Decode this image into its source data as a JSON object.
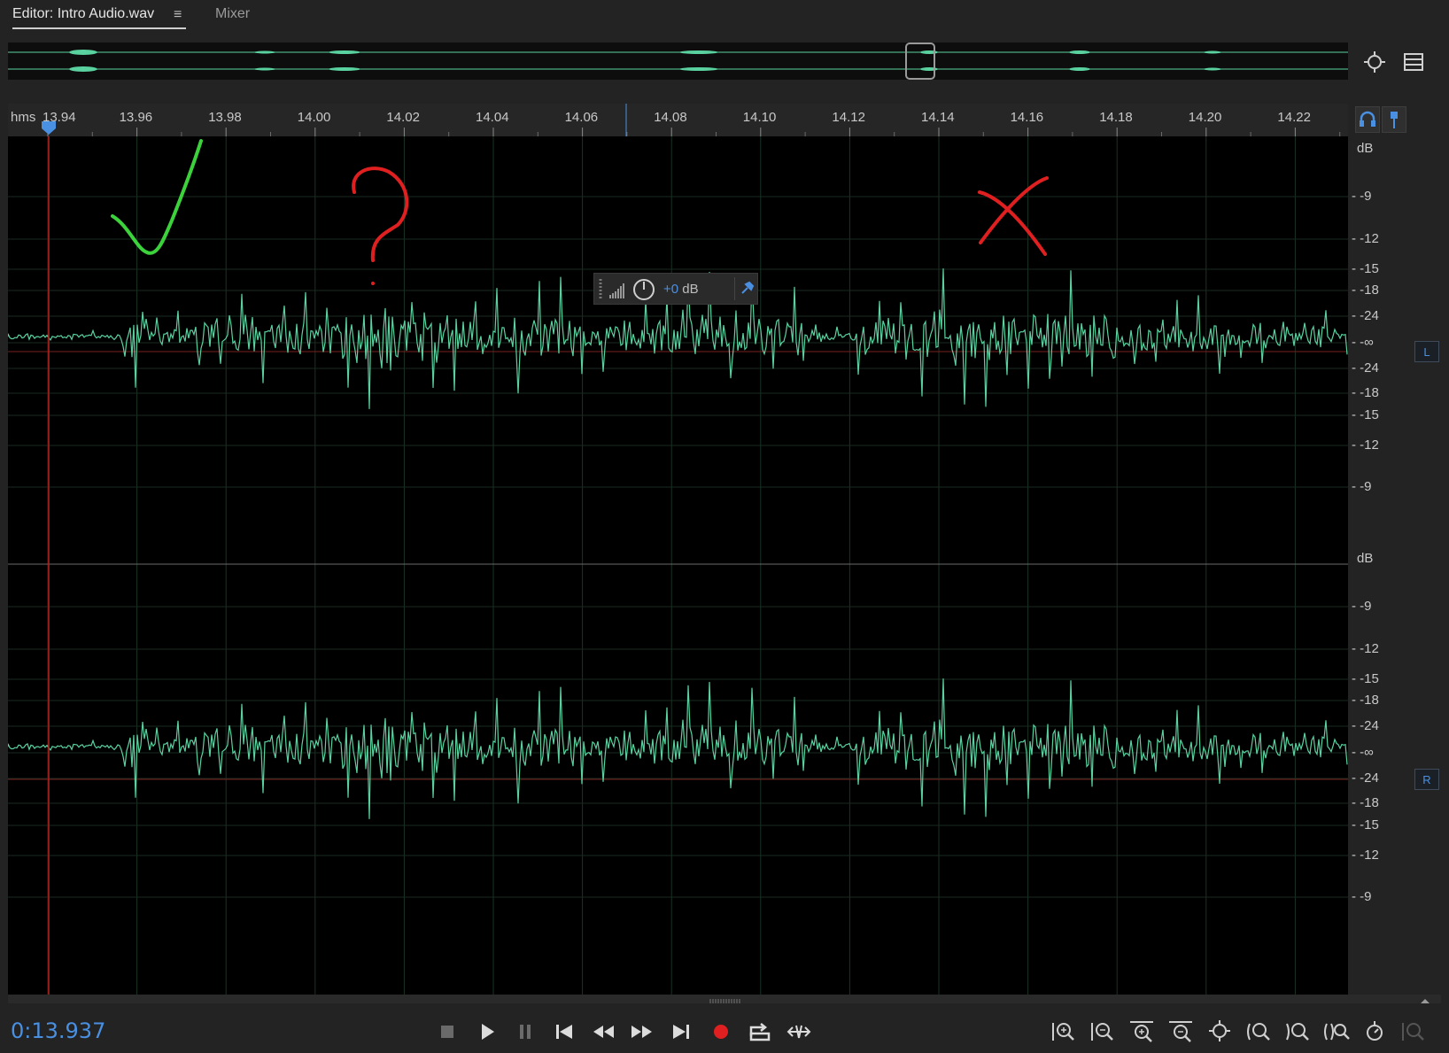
{
  "tabs": {
    "editor_label": "Editor: Intro Audio.wav",
    "menu_glyph": "≡",
    "mixer_label": "Mixer"
  },
  "ruler": {
    "unit_label": "hms",
    "ticks": [
      "13.94",
      "13.96",
      "13.98",
      "14.00",
      "14.02",
      "14.04",
      "14.06",
      "14.08",
      "14.10",
      "14.12",
      "14.14",
      "14.16",
      "14.18",
      "14.20",
      "14.22"
    ]
  },
  "channels": [
    {
      "badge": "L",
      "db_labels": [
        "dB",
        "-9",
        "-12",
        "-15",
        "-18",
        "-24",
        "-∞",
        "-24",
        "-18",
        "-15",
        "-12",
        "-9"
      ]
    },
    {
      "badge": "R",
      "db_labels": [
        "dB",
        "-9",
        "-12",
        "-15",
        "-18",
        "-24",
        "-∞",
        "-24",
        "-18",
        "-15",
        "-12",
        "-9"
      ]
    }
  ],
  "hud": {
    "value": "+0",
    "unit": "dB"
  },
  "transport": {
    "timecode": "0:13.937"
  },
  "icons": {
    "zoom_all": "zoom-to-fit-icon",
    "menu": "list-menu-icon",
    "headphones": "headphones-icon",
    "marker": "marker-pin-icon",
    "stop": "stop-icon",
    "play": "play-icon",
    "pause": "pause-icon",
    "prev": "skip-to-start-icon",
    "rewind": "rewind-icon",
    "ffwd": "fast-forward-icon",
    "next": "skip-to-end-icon",
    "record": "record-icon",
    "loop": "loop-icon",
    "skip": "skip-selection-icon"
  },
  "colors": {
    "waveform": "#5ad2a0",
    "accent": "#4a90e2",
    "annotation_check": "#3cd23c",
    "annotation_question": "#e02020",
    "annotation_cross": "#e02020",
    "playhead": "#c01818"
  }
}
